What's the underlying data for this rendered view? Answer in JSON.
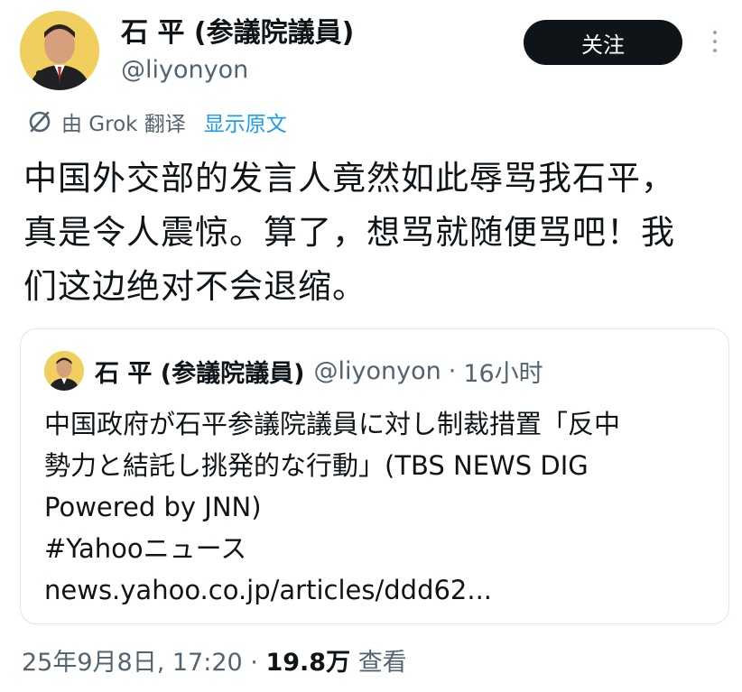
{
  "author": {
    "display_name": "石 平 (参議院議員)",
    "handle": "@liyonyon"
  },
  "follow_button": {
    "label": "关注"
  },
  "translation": {
    "by_label": "由 Grok 翻译",
    "show_original": "显示原文"
  },
  "tweet_text": [
    "中国外交部的发言人竟然如此辱骂我石平，",
    "真是令人震惊。算了，想骂就随便骂吧！我",
    "们这边绝对不会退缩。"
  ],
  "quote": {
    "display_name": "石 平 (参議院議員)",
    "handle": "@liyonyon",
    "separator": "·",
    "time": "16小时",
    "lines": [
      "中国政府が石平参議院議員に対し制裁措置「反中",
      "勢力と結託し挑発的な行動」(TBS NEWS DIG",
      "Powered by JNN)",
      "#Yahooニュース",
      "news.yahoo.co.jp/articles/ddd62..."
    ]
  },
  "meta": {
    "datetime": "25年9月8日, 17:20",
    "separator": "·",
    "views_count": "19.8万",
    "views_label": "查看"
  },
  "icons": {
    "avatar": "avatar",
    "more": "more-vertical-icon",
    "translate": "translate-icon"
  },
  "colors": {
    "accent": "#1d9bf0",
    "text_primary": "#0f1419",
    "text_secondary": "#536471",
    "follow_bg": "#0f1419"
  }
}
